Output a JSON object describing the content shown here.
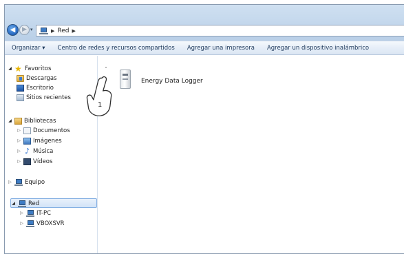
{
  "address": {
    "path": [
      "Red"
    ]
  },
  "commandbar": [
    "Organizar ▾",
    "Centro de redes y recursos compartidos",
    "Agregar una impresora",
    "Agregar un dispositivo inalámbrico"
  ],
  "tree": {
    "favorites": "Favoritos",
    "downloads": "Descargas",
    "desktop": "Escritorio",
    "recent": "Sitios recientes",
    "libraries": "Bibliotecas",
    "documents": "Documentos",
    "images": "Imágenes",
    "music": "Música",
    "videos": "Vídeos",
    "computer": "Equipo",
    "network": "Red",
    "itpc": "IT-PC",
    "vboxsvr": "VBOXSVR"
  },
  "content": {
    "device_name": "Energy Data Logger",
    "callout_number": "1"
  },
  "icons": {
    "back": "back-arrow-icon",
    "forward": "forward-arrow-icon",
    "network": "network-icon",
    "favorites": "star-icon",
    "device": "device-icon",
    "pointer": "hand-pointer-icon"
  }
}
